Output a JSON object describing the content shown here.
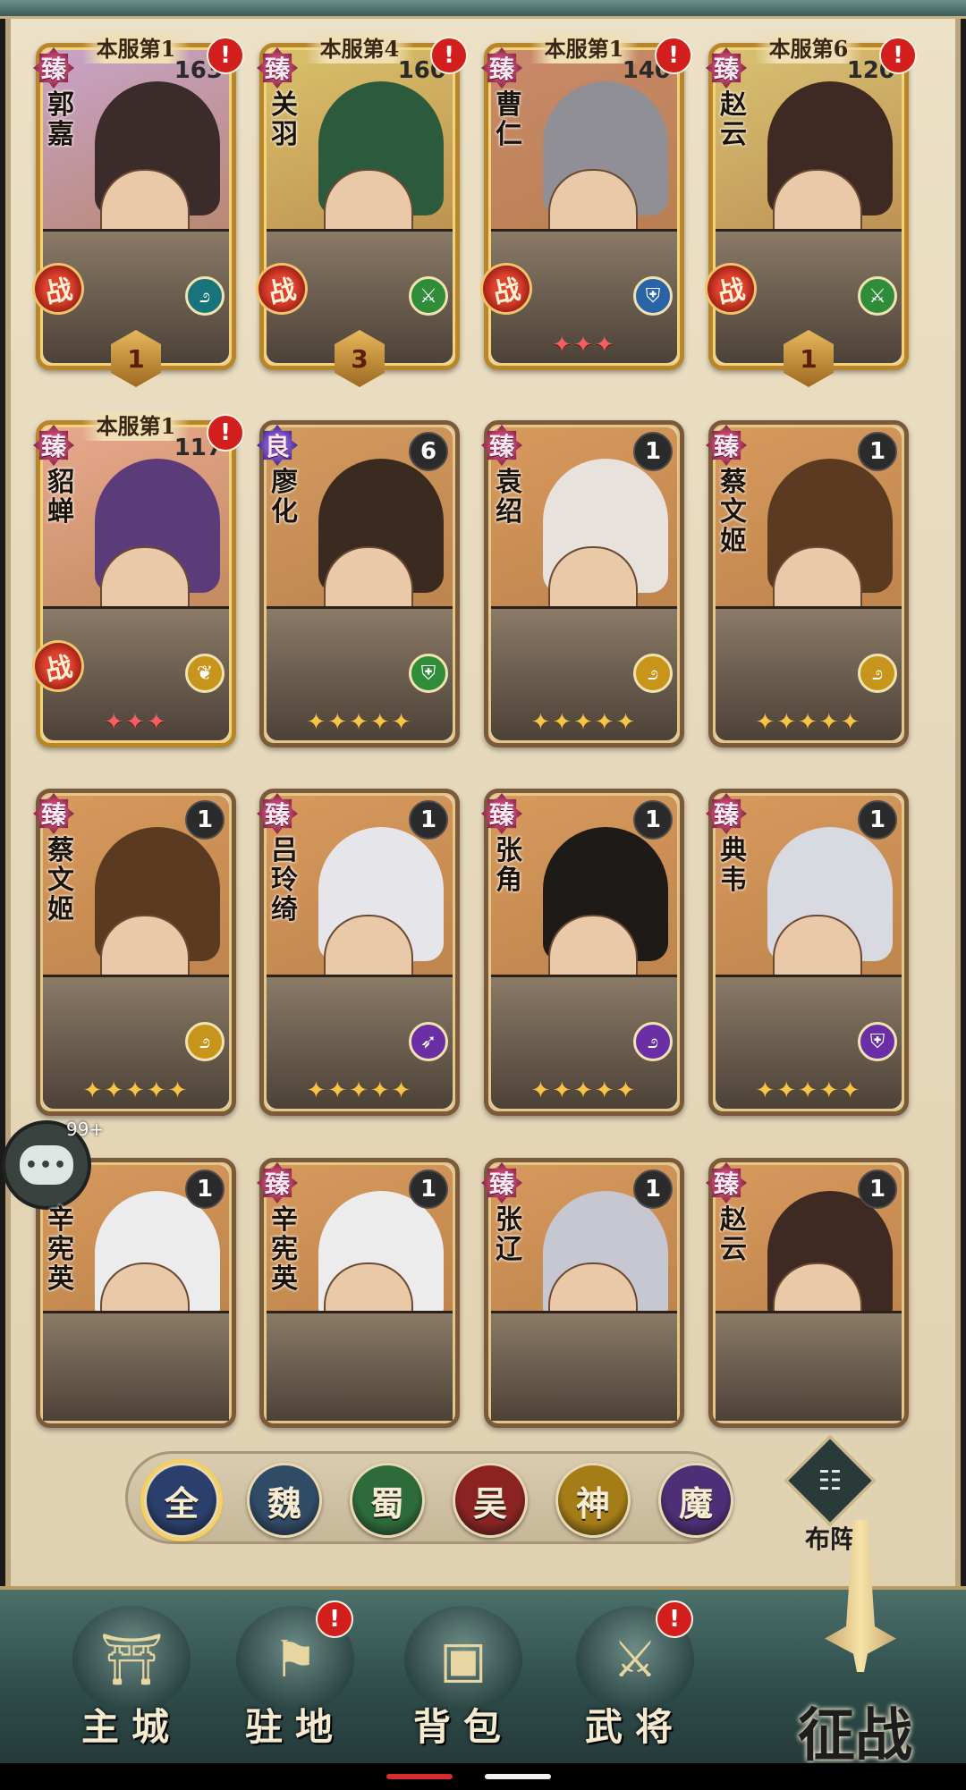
{
  "cards": [
    {
      "name": "郭嘉",
      "rank": "本服第1",
      "quality": "臻",
      "level": "163",
      "alert": "!",
      "battle": "战",
      "class_icon": "ring-strategist-icon",
      "class_color": "cyan",
      "emblem": "1",
      "stars": "",
      "bg": "#c8a3c9",
      "hair": "#3b2b2a",
      "frame": "gold"
    },
    {
      "name": "关羽",
      "rank": "本服第4",
      "quality": "臻",
      "level": "160",
      "alert": "!",
      "battle": "战",
      "class_icon": "sword-warrior-icon",
      "class_color": "green",
      "emblem": "3",
      "stars": "",
      "bg": "#d9c16a",
      "hair": "#2c5a3c",
      "frame": "gold"
    },
    {
      "name": "曹仁",
      "rank": "本服第1",
      "quality": "臻",
      "level": "140",
      "alert": "!",
      "battle": "战",
      "class_icon": "shield-defender-icon",
      "class_color": "blue",
      "emblem": "",
      "stars": "ððð",
      "stars_red": true,
      "bg": "#c98a6a",
      "hair": "#8f8f95",
      "frame": "gold"
    },
    {
      "name": "赵云",
      "rank": "本服第6",
      "quality": "臻",
      "level": "120",
      "alert": "!",
      "battle": "战",
      "class_icon": "sword-warrior-icon",
      "class_color": "green",
      "emblem": "1",
      "stars": "",
      "bg": "#d8c172",
      "hair": "#3e2a22",
      "frame": "gold"
    },
    {
      "name": "貂蝉",
      "rank": "本服第1",
      "quality": "臻",
      "level": "117",
      "alert": "!",
      "battle": "战",
      "class_icon": "leaf-support-icon",
      "class_color": "gold",
      "emblem": "",
      "stars": "ððð",
      "stars_red": true,
      "bg": "#e7a98f",
      "hair": "#5c3b7b",
      "frame": "gold"
    },
    {
      "name": "廖化",
      "rank": "",
      "quality": "良",
      "quality_purple": true,
      "level": "6",
      "alert": "",
      "battle": "",
      "class_icon": "shield-defender-icon",
      "class_color": "green",
      "emblem": "",
      "stars": "ððððð",
      "bg": "#d39a5f",
      "hair": "#3a2a20",
      "frame": "plain"
    },
    {
      "name": "袁绍",
      "rank": "",
      "quality": "臻",
      "level": "1",
      "alert": "",
      "battle": "",
      "class_icon": "ring-strategist-icon",
      "class_color": "gold",
      "emblem": "",
      "stars": "ððððð",
      "bg": "#d8995c",
      "hair": "#e7e3dc",
      "frame": "plain"
    },
    {
      "name": "蔡文姬",
      "rank": "",
      "quality": "臻",
      "level": "1",
      "alert": "",
      "battle": "",
      "class_icon": "ring-strategist-icon",
      "class_color": "gold",
      "emblem": "",
      "stars": "ððððð",
      "bg": "#d8995c",
      "hair": "#5b3a22",
      "frame": "plain"
    },
    {
      "name": "蔡文姬",
      "rank": "",
      "quality": "臻",
      "level": "1",
      "alert": "",
      "battle": "",
      "class_icon": "ring-strategist-icon",
      "class_color": "gold",
      "emblem": "",
      "stars": "ððððð",
      "bg": "#d8995c",
      "hair": "#5b3a22",
      "frame": "plain"
    },
    {
      "name": "吕玲绮",
      "rank": "",
      "quality": "臻",
      "level": "1",
      "alert": "",
      "battle": "",
      "class_icon": "arrow-archer-icon",
      "class_color": "violet",
      "emblem": "",
      "stars": "ððððð",
      "bg": "#d8995c",
      "hair": "#e6e6ea",
      "frame": "plain"
    },
    {
      "name": "张角",
      "rank": "",
      "quality": "臻",
      "level": "1",
      "alert": "",
      "battle": "",
      "class_icon": "ring-strategist-icon",
      "class_color": "violet",
      "emblem": "",
      "stars": "ððððð",
      "bg": "#d8995c",
      "hair": "#1e1a17",
      "frame": "plain"
    },
    {
      "name": "典韦",
      "rank": "",
      "quality": "臻",
      "level": "1",
      "alert": "",
      "battle": "",
      "class_icon": "shield-defender-icon",
      "class_color": "violet",
      "emblem": "",
      "stars": "ððððð",
      "bg": "#d8995c",
      "hair": "#d9d9e2",
      "frame": "plain"
    },
    {
      "name": "辛宪英",
      "rank": "",
      "quality": "",
      "level": "1",
      "alert": "",
      "battle": "",
      "class_icon": "ring-strategist-icon",
      "class_color": "teal",
      "emblem": "",
      "stars": "",
      "bg": "#d8995c",
      "hair": "#ececec",
      "frame": "plain"
    },
    {
      "name": "辛宪英",
      "rank": "",
      "quality": "臻",
      "level": "1",
      "alert": "",
      "battle": "",
      "class_icon": "ring-strategist-icon",
      "class_color": "teal",
      "emblem": "",
      "stars": "",
      "bg": "#d8995c",
      "hair": "#ececec",
      "frame": "plain"
    },
    {
      "name": "张辽",
      "rank": "",
      "quality": "臻",
      "level": "1",
      "alert": "",
      "battle": "",
      "class_icon": "sword-warrior-icon",
      "class_color": "teal",
      "emblem": "",
      "stars": "",
      "bg": "#d8995c",
      "hair": "#c7c7d2",
      "frame": "plain"
    },
    {
      "name": "赵云",
      "rank": "",
      "quality": "臻",
      "level": "1",
      "alert": "",
      "battle": "",
      "class_icon": "sword-warrior-icon",
      "class_color": "teal",
      "emblem": "",
      "stars": "",
      "bg": "#d8995c",
      "hair": "#3e2a22",
      "frame": "plain"
    }
  ],
  "factions": [
    {
      "label": "全",
      "color": "#2a3f6b",
      "selected": true
    },
    {
      "label": "魏",
      "color": "#2f4b66",
      "selected": false
    },
    {
      "label": "蜀",
      "color": "#2d6b3a",
      "selected": false
    },
    {
      "label": "吴",
      "color": "#8b2323",
      "selected": false
    },
    {
      "label": "神",
      "color": "#a57d16",
      "selected": false
    },
    {
      "label": "魔",
      "color": "#4e2f77",
      "selected": false
    }
  ],
  "formation": {
    "label": "布阵",
    "icon": "formation-people-icon"
  },
  "chat": {
    "badge": "99+",
    "icon": "chat-bubble-icon"
  },
  "nav": [
    {
      "label": "主城",
      "icon": "castle-icon",
      "glyph": "⛩",
      "alert": ""
    },
    {
      "label": "驻地",
      "icon": "garrison-icon",
      "glyph": "⚑",
      "alert": "!"
    },
    {
      "label": "背包",
      "icon": "treasure-chest-icon",
      "glyph": "▣",
      "alert": ""
    },
    {
      "label": "武将",
      "icon": "general-helmet-icon",
      "glyph": "⚔",
      "alert": "!"
    }
  ],
  "battle_button": {
    "label": "征战",
    "icon": "sword-icon"
  },
  "class_glyphs": {
    "ring-strategist-icon": "೨",
    "sword-warrior-icon": "⚔",
    "shield-defender-icon": "⛨",
    "leaf-support-icon": "❦",
    "arrow-archer-icon": "➶"
  }
}
